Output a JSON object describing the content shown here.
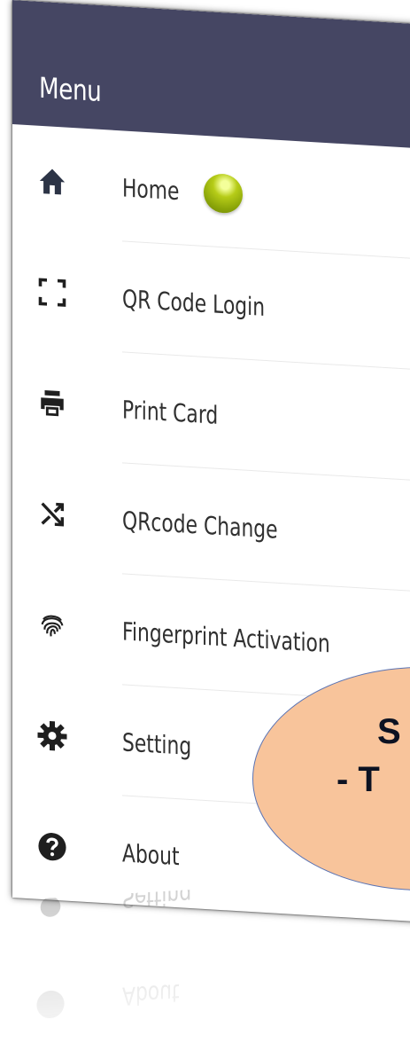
{
  "header": {
    "title": "Menu",
    "background": "#454663"
  },
  "menu": {
    "items": [
      {
        "label": "Home",
        "icon": "home-icon"
      },
      {
        "label": "QR Code Login",
        "icon": "qr-scan-icon"
      },
      {
        "label": "Print Card",
        "icon": "printer-icon"
      },
      {
        "label": "QRcode Change",
        "icon": "shuffle-icon"
      },
      {
        "label": "Fingerprint Activation",
        "icon": "fingerprint-icon"
      },
      {
        "label": "Setting",
        "icon": "gear-icon"
      },
      {
        "label": "About",
        "icon": "help-circle-icon"
      }
    ],
    "status_dot_color": "#9bb812"
  },
  "callout": {
    "line1": "S",
    "line2": "- T",
    "fill": "#f8c49b",
    "border": "#5b74b4"
  },
  "reflection": {
    "items": [
      {
        "label": "About",
        "icon": "help-circle-icon"
      },
      {
        "label": "Setting",
        "icon": "gear-icon"
      }
    ]
  }
}
